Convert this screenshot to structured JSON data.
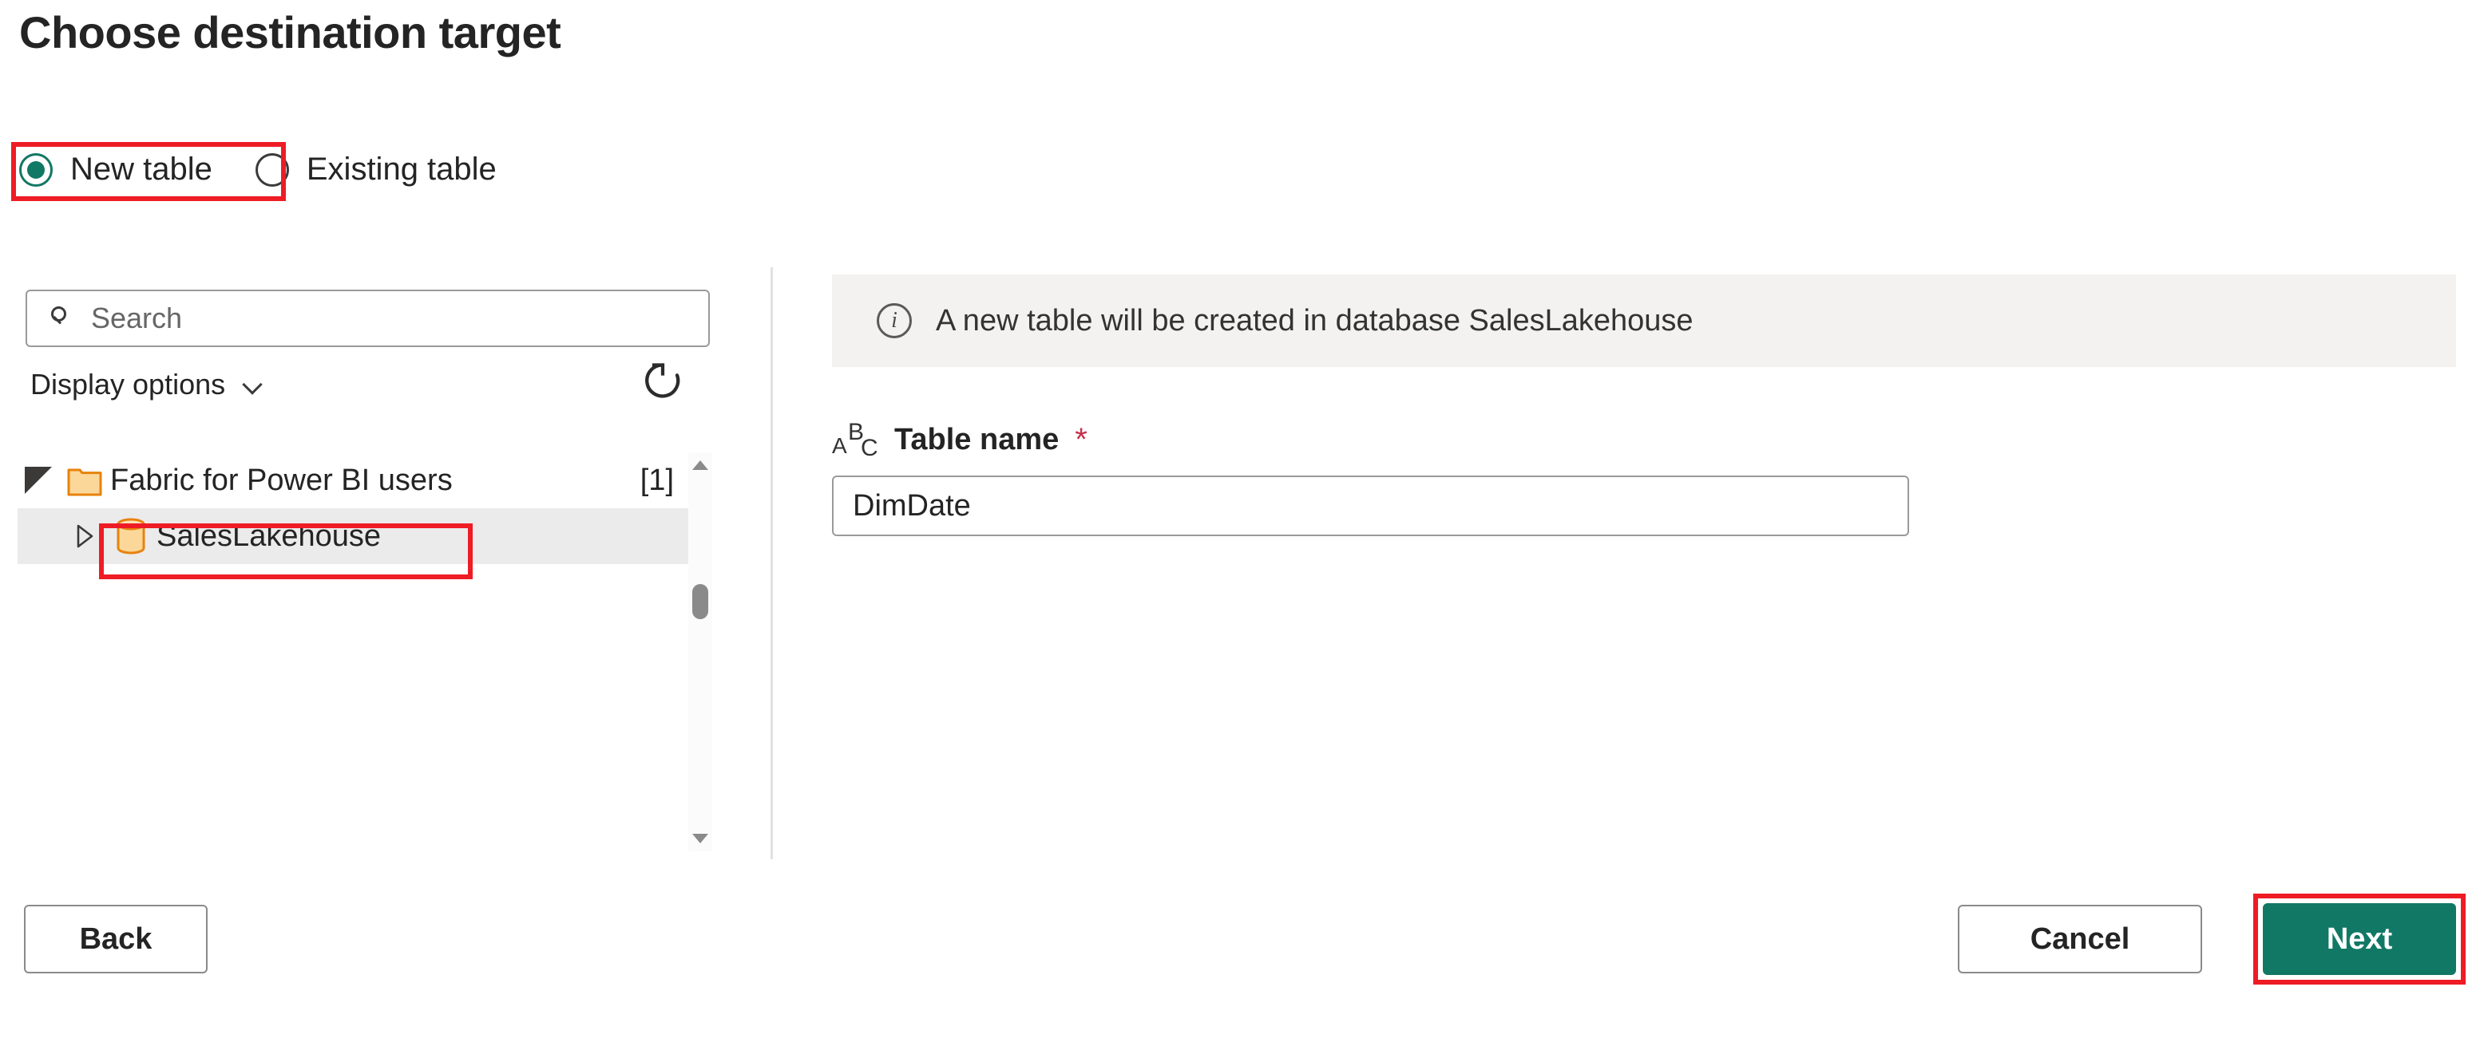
{
  "page": {
    "title": "Choose destination target"
  },
  "destination_mode": {
    "options": [
      {
        "label": "New table",
        "selected": true
      },
      {
        "label": "Existing table",
        "selected": false
      }
    ]
  },
  "navigator": {
    "search": {
      "placeholder": "Search",
      "value": "",
      "icon": "search-icon"
    },
    "display_options": {
      "label": "Display options",
      "icon": "chevron-down-icon"
    },
    "refresh": {
      "label": "Refresh",
      "icon": "refresh-icon"
    },
    "tree": [
      {
        "label": "Fabric for Power BI users",
        "count": "[1]",
        "icon": "folder-icon",
        "expanded": true,
        "selected": false,
        "level": 0
      },
      {
        "label": "SalesLakehouse",
        "count": "",
        "icon": "database-icon",
        "expanded": false,
        "selected": true,
        "level": 1
      }
    ],
    "scrollbar": {
      "up_icon": "scroll-up-arrow-icon",
      "down_icon": "scroll-down-arrow-icon"
    }
  },
  "details": {
    "info_banner": {
      "icon": "info-icon",
      "text": "A new table will be created in database SalesLakehouse"
    },
    "table_name_field": {
      "icon": "abc-text-type-icon",
      "label": "Table name",
      "required_marker": "*",
      "value": "DimDate",
      "placeholder": ""
    }
  },
  "footer": {
    "back_label": "Back",
    "cancel_label": "Cancel",
    "next_label": "Next"
  },
  "colors": {
    "accent": "#117865",
    "annotation": "#ee1c25",
    "required": "#c4314b",
    "info_bg": "#f3f2f1",
    "selected_row": "#ebebeb"
  }
}
